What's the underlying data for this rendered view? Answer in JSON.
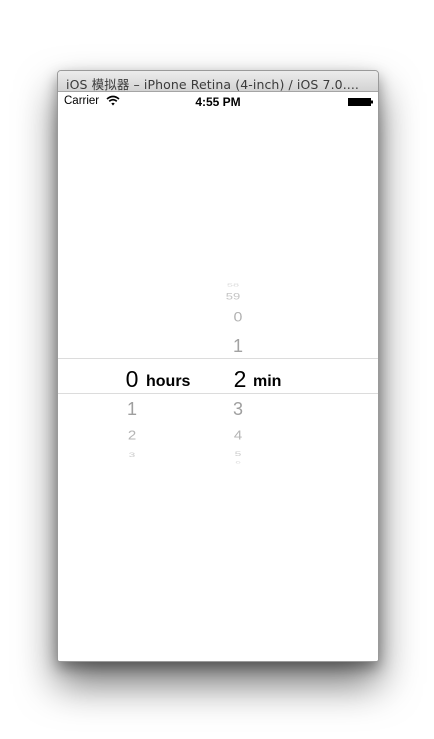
{
  "window": {
    "title": "iOS 模拟器 – iPhone Retina (4-inch) / iOS 7.0...."
  },
  "status_bar": {
    "carrier": "Carrier",
    "time": "4:55 PM",
    "wifi_icon": "wifi-icon",
    "battery_icon": "battery-icon",
    "battery_level": 1.0
  },
  "picker": {
    "hours": {
      "above": [
        "",
        "",
        ""
      ],
      "selected": "0",
      "below": [
        "1",
        "2",
        "3"
      ],
      "unit": "hours"
    },
    "minutes": {
      "above": [
        "58",
        "59",
        "0",
        "1"
      ],
      "selected": "2",
      "below": [
        "3",
        "4",
        "5",
        "6"
      ],
      "unit": "min"
    }
  }
}
